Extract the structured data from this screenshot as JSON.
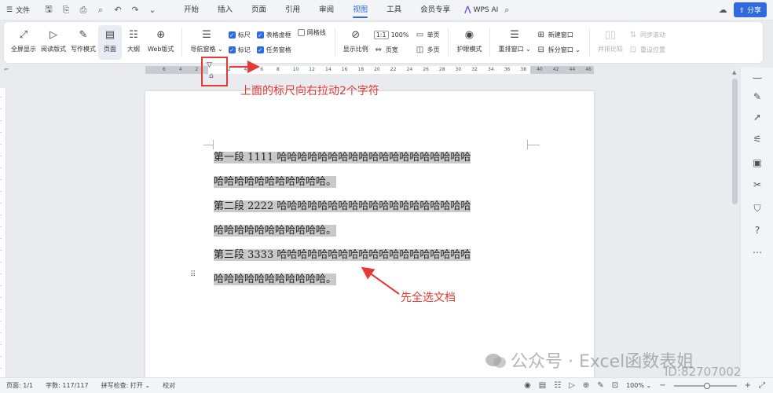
{
  "menubar": {
    "file_label": "文件",
    "items": [
      "开始",
      "插入",
      "页面",
      "引用",
      "审阅",
      "视图",
      "工具",
      "会员专享"
    ],
    "active_index": 5,
    "wps_ai": "WPS AI",
    "share": "分享"
  },
  "ribbon": {
    "view_modes": [
      {
        "label": "全屏显示",
        "icon": "fullscreen-icon"
      },
      {
        "label": "阅读版式",
        "icon": "read-mode-icon"
      },
      {
        "label": "写作模式",
        "icon": "write-mode-icon"
      },
      {
        "label": "页面",
        "icon": "page-icon"
      },
      {
        "label": "大纲",
        "icon": "outline-icon"
      },
      {
        "label": "Web版式",
        "icon": "web-icon"
      }
    ],
    "nav_pane": "导航窗格",
    "checks_col1": [
      {
        "label": "标尺",
        "checked": true
      },
      {
        "label": "标记",
        "checked": true
      }
    ],
    "checks_col2": [
      {
        "label": "表格虚框",
        "checked": true
      },
      {
        "label": "任务窗格",
        "checked": true
      }
    ],
    "checks_col3": [
      {
        "label": "网格线",
        "checked": false
      }
    ],
    "display_ratio": "显示比例",
    "zoom_100": "100%",
    "page_width": "页宽",
    "single_page": "单页",
    "multi_page": "多页",
    "eye_mode": "护眼模式",
    "rearrange_window": "重排窗口",
    "new_window": "新建窗口",
    "split_window": "拆分窗口",
    "side_by_side": "并排比较",
    "sync_scroll": "同步滚动",
    "reset_position": "重设位置"
  },
  "ruler": {
    "ticks": [
      "6",
      "4",
      "2",
      "",
      "2",
      "4",
      "6",
      "8",
      "10",
      "12",
      "14",
      "16",
      "18",
      "20",
      "22",
      "24",
      "26",
      "28",
      "30",
      "32",
      "34",
      "36",
      "38",
      "40",
      "42",
      "44",
      "46"
    ]
  },
  "document": {
    "lines": [
      "第一段 1111 哈哈哈哈哈哈哈哈哈哈哈哈哈哈哈哈哈哈哈",
      "哈哈哈哈哈哈哈哈哈哈哈。",
      "第二段 2222 哈哈哈哈哈哈哈哈哈哈哈哈哈哈哈哈哈哈哈",
      "哈哈哈哈哈哈哈哈哈哈哈。",
      "第三段 3333 哈哈哈哈哈哈哈哈哈哈哈哈哈哈哈哈哈哈哈",
      "哈哈哈哈哈哈哈哈哈哈哈。"
    ]
  },
  "annotations": {
    "ruler_note": "上面的标尺向右拉动2个字符",
    "select_note": "先全选文档",
    "color": "#e53935"
  },
  "watermark": {
    "text": "公众号 · Excel函数表姐",
    "id": "ID:82707002"
  },
  "statusbar": {
    "page": "页面: 1/1",
    "words": "字数: 117/117",
    "spell": "拼写检查: 打开",
    "proof": "校对",
    "zoom": "100%"
  },
  "colors": {
    "accent": "#2f6bdf",
    "selection": "#c9c9c9"
  }
}
